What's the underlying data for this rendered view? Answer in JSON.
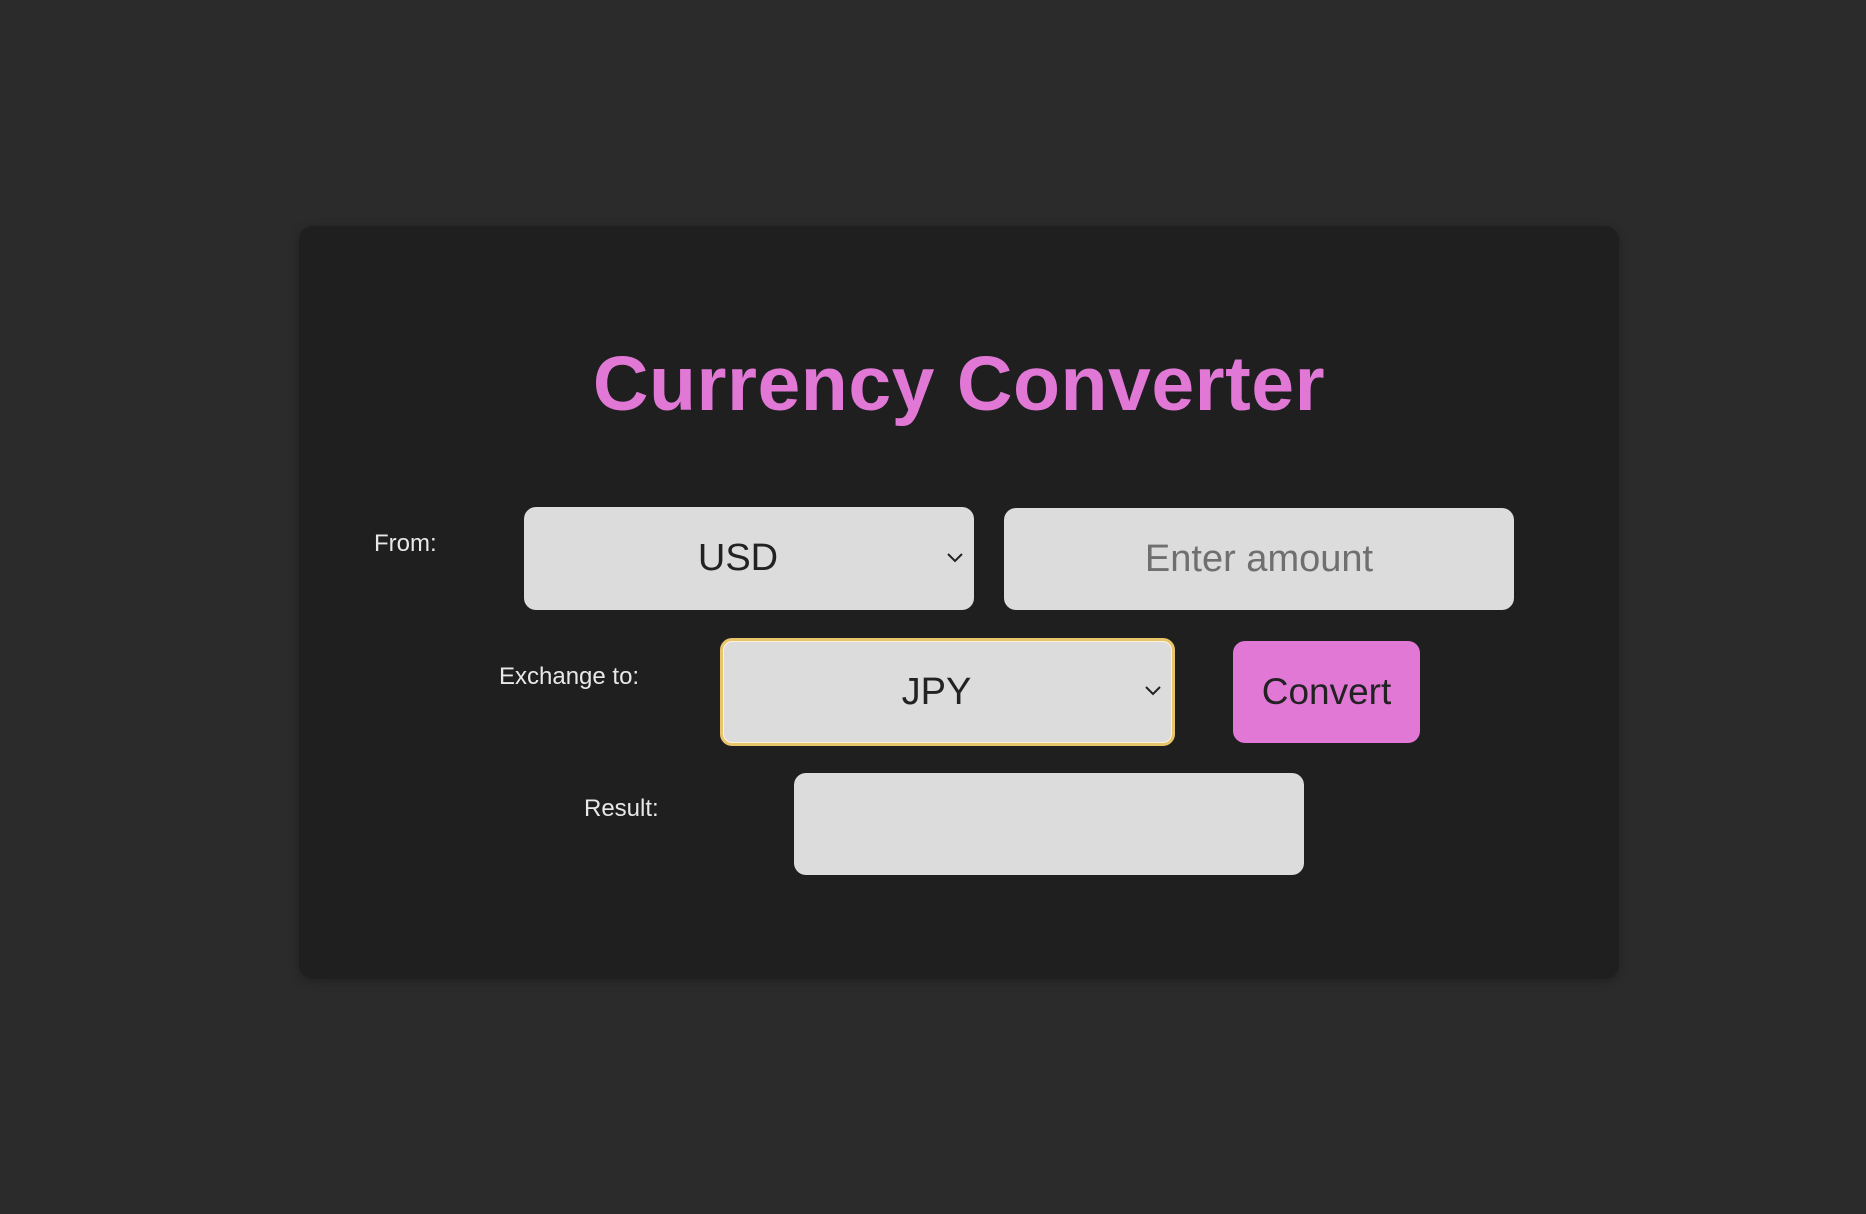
{
  "app": {
    "title": "Currency Converter",
    "accent_color": "#e178d6",
    "background_color": "#2b2b2b",
    "card_color": "#1f1f1f",
    "focus_color": "#e9c46a"
  },
  "form": {
    "from": {
      "label": "From:",
      "selected_currency": "USD",
      "amount_value": "",
      "amount_placeholder": "Enter amount",
      "dropdown_icon": "chevron-down-icon"
    },
    "to": {
      "label": "Exchange to:",
      "selected_currency": "JPY",
      "dropdown_icon": "chevron-down-icon",
      "focused": true
    },
    "convert_label": "Convert",
    "result": {
      "label": "Result:",
      "value": ""
    }
  }
}
